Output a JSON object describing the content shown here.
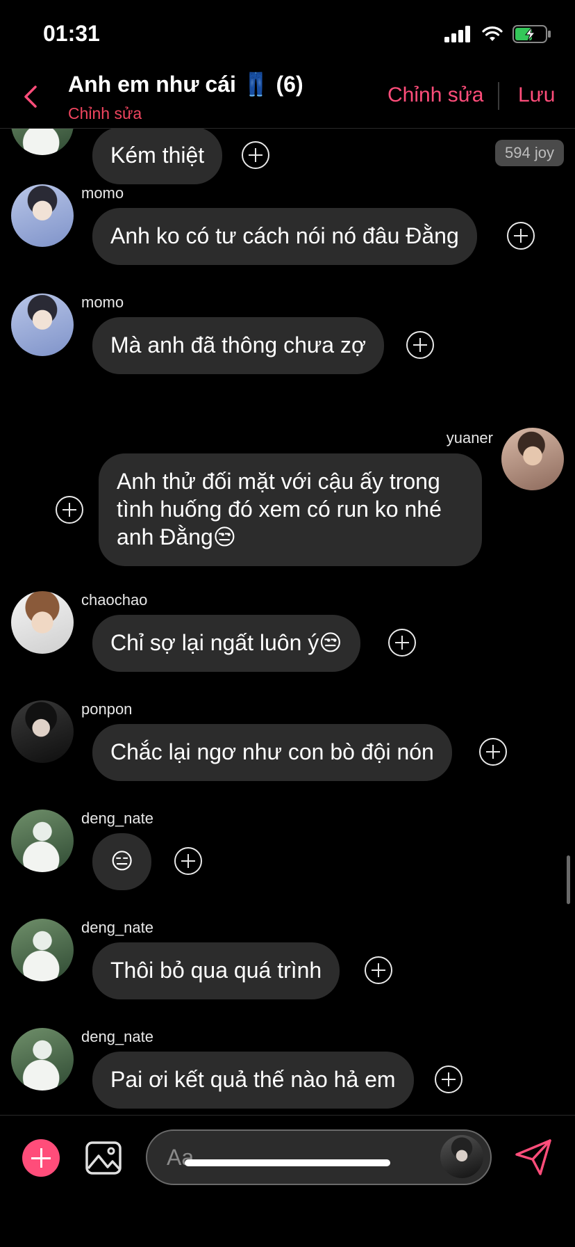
{
  "status": {
    "time": "01:31"
  },
  "header": {
    "title": "Anh em như cái 👖 (6)",
    "subtitle": "Chỉnh sửa",
    "edit_label": "Chỉnh sửa",
    "save_label": "Lưu"
  },
  "messages": [
    {
      "sender": "",
      "text": "Kém thiệt",
      "side": "left",
      "badge": "594 joy"
    },
    {
      "sender": "momo",
      "text": "Anh ko có tư cách nói nó đâu Đằng",
      "side": "left"
    },
    {
      "sender": "momo",
      "text": "Mà anh đã thông chưa zợ",
      "side": "left"
    },
    {
      "sender": "yuaner",
      "text": "Anh thử đối mặt với cậu ấy trong tình huống đó xem có run ko nhé anh Đằng😒",
      "side": "right"
    },
    {
      "sender": "chaochao",
      "text": "Chỉ sợ lại ngất luôn ý😒",
      "side": "left"
    },
    {
      "sender": "ponpon",
      "text": "Chắc lại ngơ như con bò đội nón",
      "side": "left"
    },
    {
      "sender": "deng_nate",
      "text": "😑",
      "side": "left"
    },
    {
      "sender": "deng_nate",
      "text": "Thôi bỏ qua quá trình",
      "side": "left"
    },
    {
      "sender": "deng_nate",
      "text": "Pai ơi kết quả thế nào hả em",
      "side": "left"
    }
  ],
  "composer": {
    "placeholder": "Aa"
  },
  "colors": {
    "accent": "#ff4d7a",
    "subtitle": "#f0455f",
    "bubble": "#2c2c2c",
    "background": "#000000"
  },
  "icons": [
    "back-chevron-icon",
    "signal-icon",
    "wifi-icon",
    "battery-charging-icon",
    "plus-circle-icon",
    "add-icon",
    "image-icon",
    "send-icon"
  ]
}
